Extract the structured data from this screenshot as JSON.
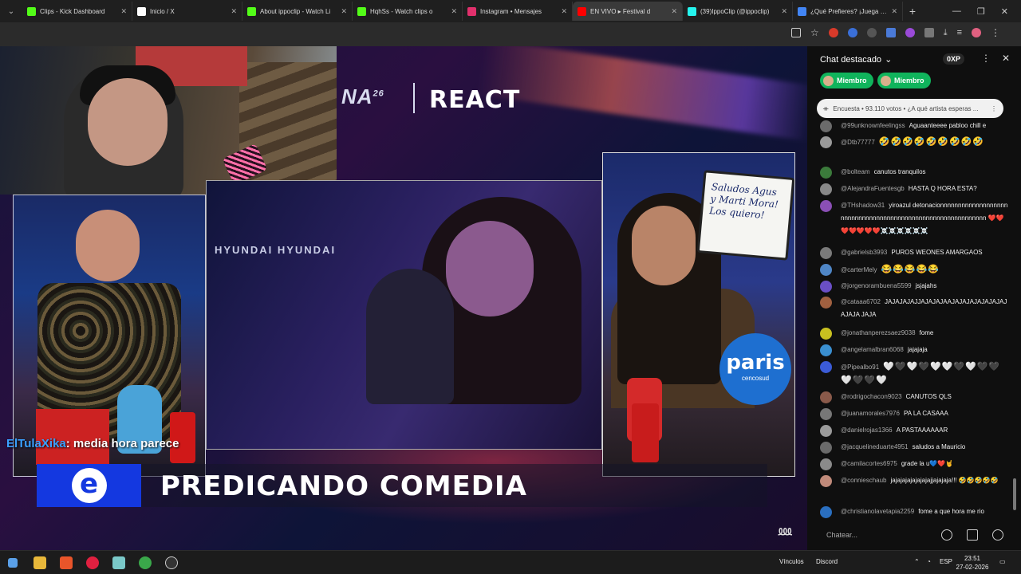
{
  "tabs": [
    {
      "label": "Clips - Kick Dashboard",
      "color": "#53fc18",
      "active": false
    },
    {
      "label": "Inicio / X",
      "color": "#ffffff",
      "active": false
    },
    {
      "label": "About ippoclip - Watch Li",
      "color": "#53fc18",
      "active": false
    },
    {
      "label": "HqhSs - Watch clips o",
      "color": "#53fc18",
      "active": false
    },
    {
      "label": "Instagram • Mensajes",
      "color": "#e1306c",
      "active": false
    },
    {
      "label": "EN VIVO ▸ Festival d",
      "color": "#ff0000",
      "active": true
    },
    {
      "label": "(39)IppoClip (@ippoclip)",
      "color": "#25f4ee",
      "active": false
    },
    {
      "label": "¿Qué Prefieres? ¡Juega en",
      "color": "#4285f4",
      "active": false
    }
  ],
  "video": {
    "logo_text": "NA",
    "logo_sup": "26",
    "react_label": "REACT",
    "center_banner": "HYUNDAI   HYUNDAI",
    "whiteboard_text": "Saludos Agus y Marti Mora! Los quiero!",
    "paris_word": "paris",
    "paris_sub": "cencosud",
    "overlay_user": "ElTulaXika",
    "overlay_message": ": media hora parece",
    "lower_third_logo": "e",
    "lower_third_title": "PREDICANDO COMEDIA"
  },
  "chat": {
    "header_title": "Chat destacado",
    "xp": "0XP",
    "member_chips": [
      "Miembro",
      "Miembro"
    ],
    "poll": "Encuesta • 93.110 votos • ¿A qué artista esperas ...",
    "messages": [
      {
        "user": "@99unknownfeelingss",
        "text": "Aguaanteeee pabloo chill e",
        "avatar_color": "#6b6b6b"
      },
      {
        "user": "@Dtb77777",
        "text": "🤣🤣🤣🤣🤣🤣🤣🤣🤣",
        "avatar_color": "#9a9a9a"
      },
      {
        "user": "@bolteam",
        "text": "canutos tranquilos",
        "avatar_color": "#3b7a3b"
      },
      {
        "user": "@AlejandraFuentesgb",
        "text": "HASTA Q HORA ESTA?",
        "avatar_color": "#888888"
      },
      {
        "user": "@THshadow31",
        "text": "yiroazul detonacionnnnnnnnnnnnnnnnnnnnnnnnnnnnnnnnnnnnnnnnnnnnnnnnnnnnnnnnnnnn ❤️❤️❤️❤️❤️❤️❤️☠️☠️☠️☠️☠️☠️",
        "avatar_color": "#8a4fb5"
      },
      {
        "user": "@gabrielsb3993",
        "text": "PUROS WEONES AMARGAOS",
        "avatar_color": "#7a7a7a"
      },
      {
        "user": "@carterMely",
        "text": "😂😂😂😂😂",
        "avatar_color": "#4f86c6"
      },
      {
        "user": "@jorgenorambuena5599",
        "text": "jsjajahs",
        "avatar_color": "#6a4fc6"
      },
      {
        "user": "@cataaa6702",
        "text": "JAJAJAJAJJAJAJAJAAJAJAJAJAJAJAJAJAJAJA JAJA",
        "avatar_color": "#a06040"
      },
      {
        "user": "@jonathanperezsaez9038",
        "text": "fome",
        "avatar_color": "#c8c020"
      },
      {
        "user": "@angelamalbran6068",
        "text": "jajajaja",
        "avatar_color": "#3a8fd0"
      },
      {
        "user": "@Pipealbo91",
        "text": "🤍🖤🤍🖤🤍🤍🖤🤍🖤🖤🤍🖤🖤🤍",
        "avatar_color": "#3b5bd6"
      },
      {
        "user": "@rodrigochacon9023",
        "text": "CANUTOS QLS",
        "avatar_color": "#8a5a4a"
      },
      {
        "user": "@juanamorales7976",
        "text": "PA LA CASAAA",
        "avatar_color": "#777777"
      },
      {
        "user": "@danielrojas1366",
        "text": "A PASTAAAAAAR",
        "avatar_color": "#9a9a9a"
      },
      {
        "user": "@jacquelineduarte4951",
        "text": "saludos a Mauricio",
        "avatar_color": "#6a6a6a"
      },
      {
        "user": "@camilacortes6975",
        "text": "grade la u💙❤️🤘",
        "avatar_color": "#8a8a8a"
      },
      {
        "user": "@connieschaub",
        "text": "jajajajajajajajajjajajaja!!! 🤣🤣🤣🤣🤣",
        "avatar_color": "#c08a7a"
      },
      {
        "user": "@christianolavetapia2259",
        "text": "fome a que hora me rio",
        "avatar_color": "#2a6fc0"
      }
    ],
    "input_placeholder": "Chatear..."
  },
  "taskbar": {
    "vinculos": "Vínculos",
    "discord": "Discord",
    "lang": "ESP",
    "time": "23:51",
    "date": "27-02-2026"
  }
}
